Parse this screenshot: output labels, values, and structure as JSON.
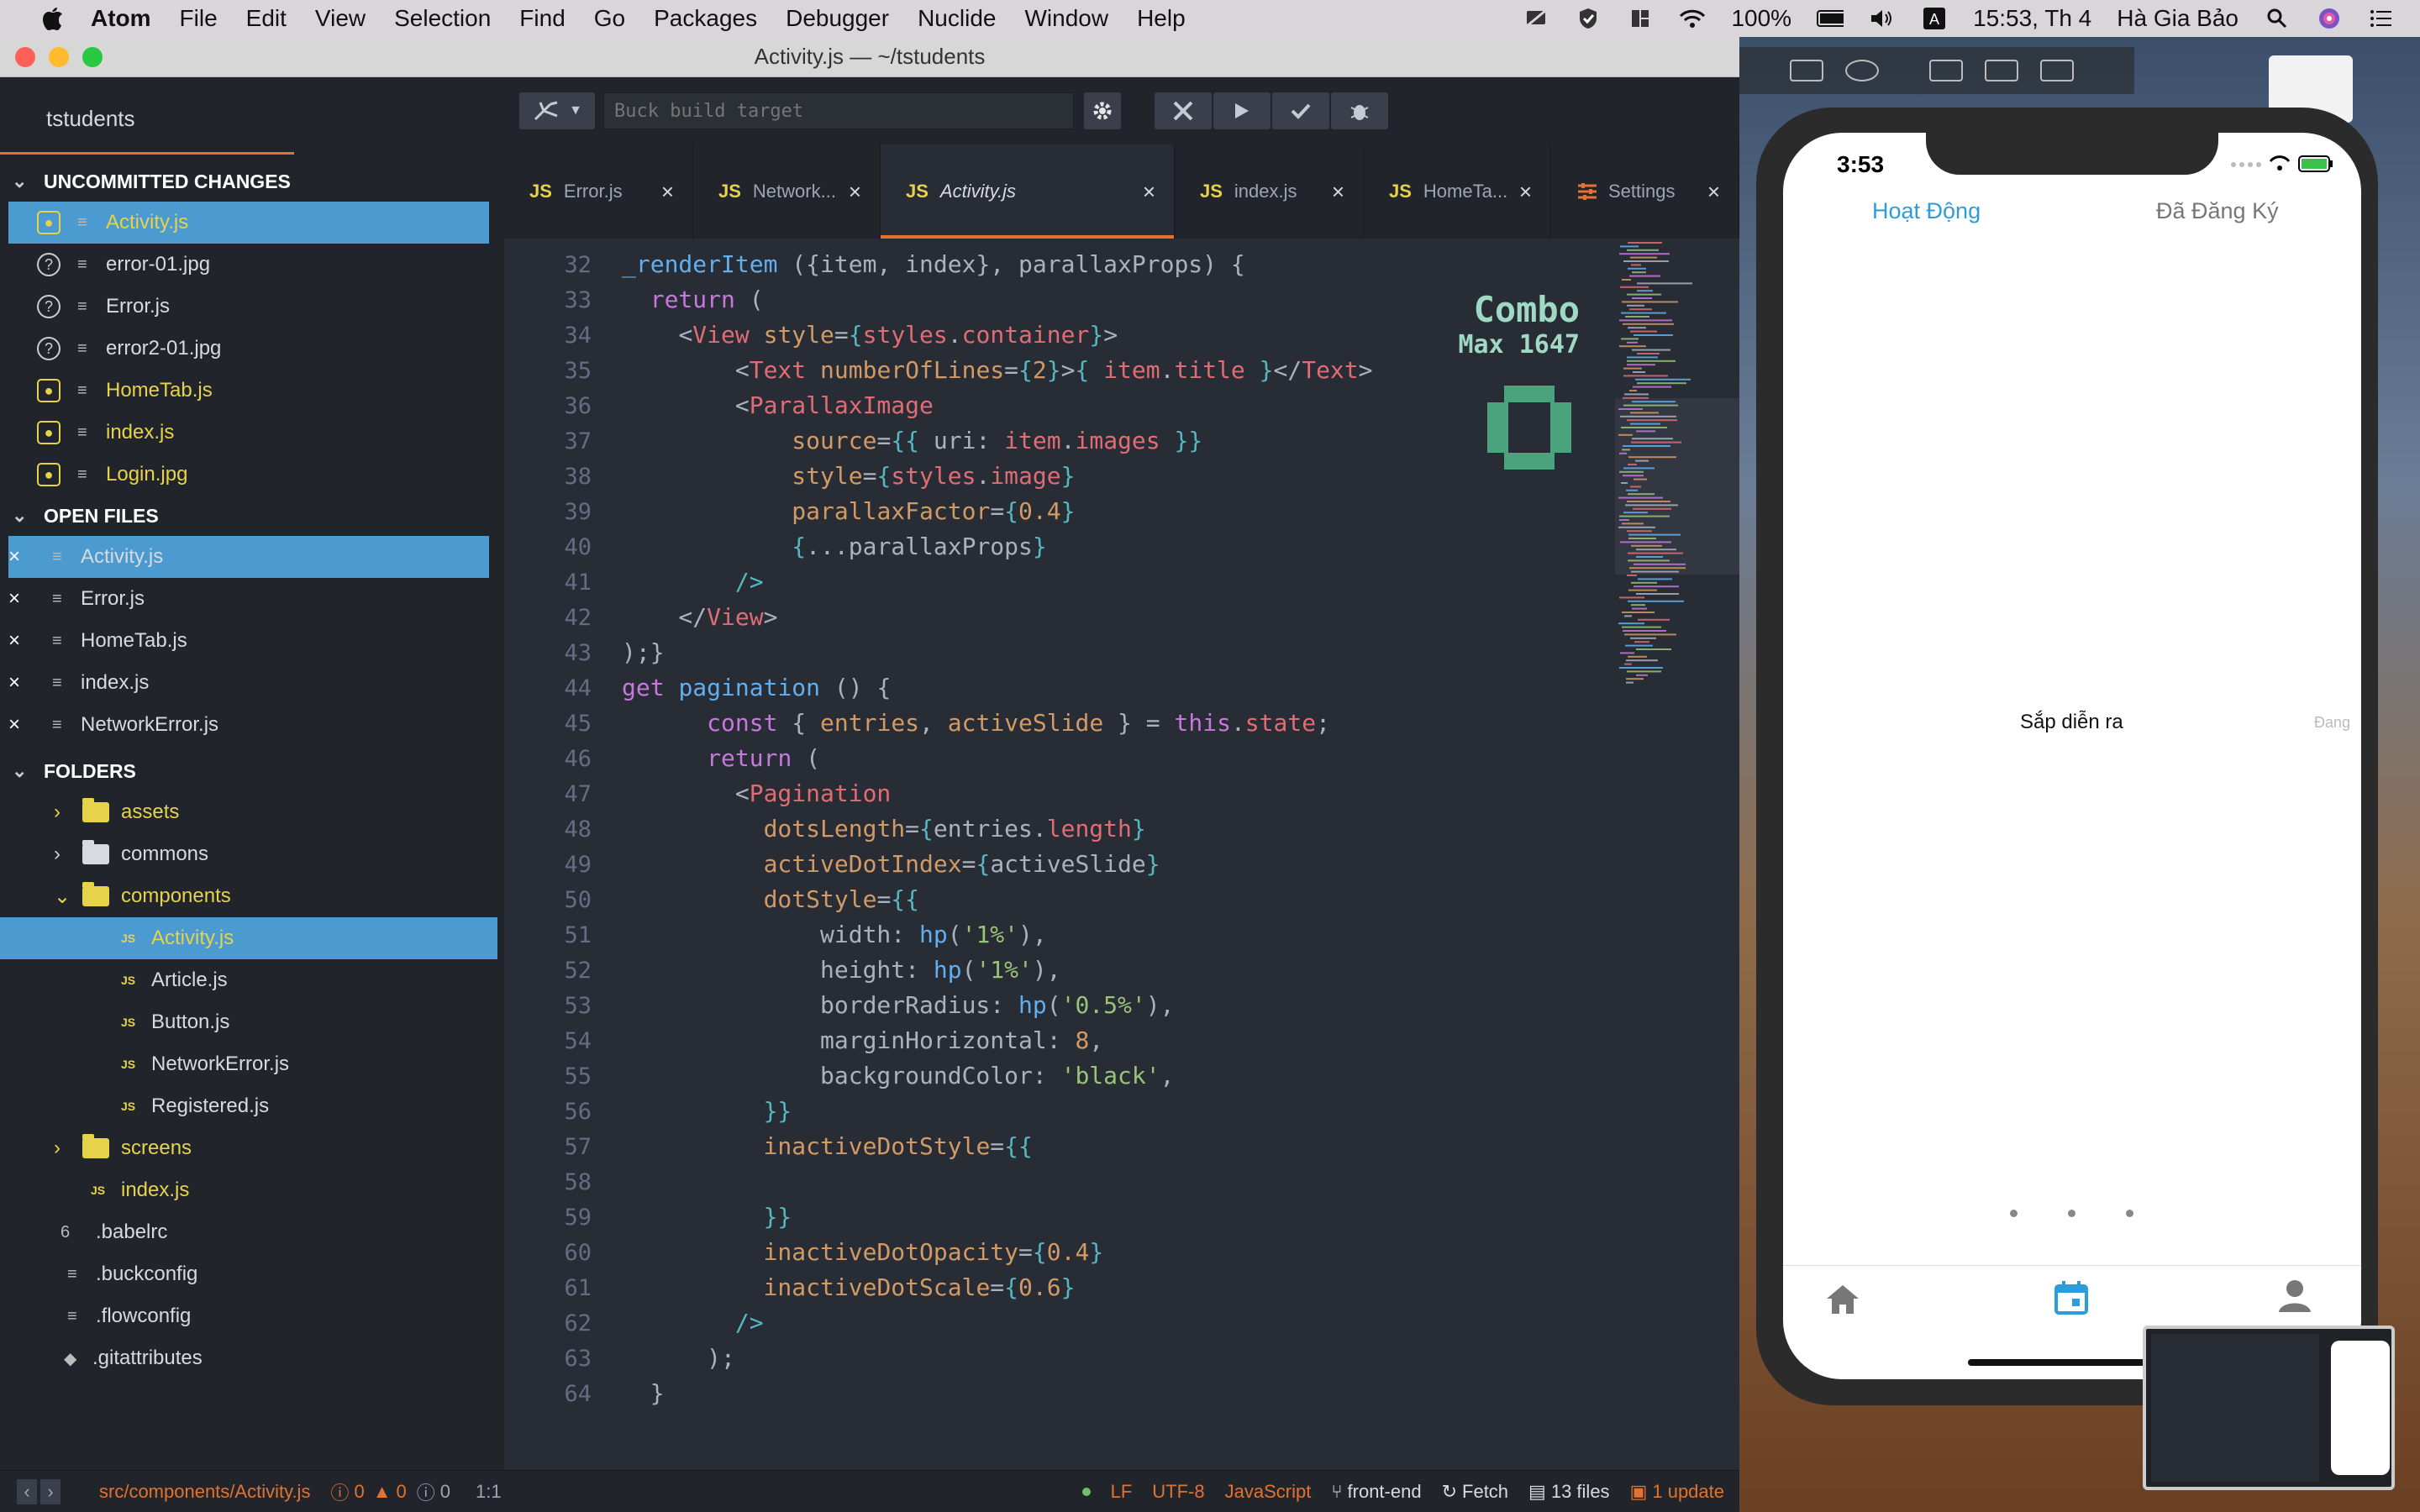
{
  "menubar": {
    "app": "Atom",
    "items": [
      "File",
      "Edit",
      "View",
      "Selection",
      "Find",
      "Go",
      "Packages",
      "Debugger",
      "Nuclide",
      "Window",
      "Help"
    ],
    "battery": "100%",
    "clock": "15:53, Th 4",
    "user": "Hà Gia Bảo"
  },
  "window": {
    "title": "Activity.js — ~/tstudents"
  },
  "tree": {
    "project": "tstudents",
    "uncommitted_title": "UNCOMMITTED CHANGES",
    "uncommitted": [
      {
        "name": "Activity.js",
        "status": "added"
      },
      {
        "name": "error-01.jpg",
        "status": "untracked"
      },
      {
        "name": "Error.js",
        "status": "untracked"
      },
      {
        "name": "error2-01.jpg",
        "status": "untracked"
      },
      {
        "name": "HomeTab.js",
        "status": "added"
      },
      {
        "name": "index.js",
        "status": "added"
      },
      {
        "name": "Login.jpg",
        "status": "added"
      }
    ],
    "open_files_title": "OPEN FILES",
    "open_files": [
      "Activity.js",
      "Error.js",
      "HomeTab.js",
      "index.js",
      "NetworkError.js"
    ],
    "folders_title": "FOLDERS",
    "folders": {
      "assets": "assets",
      "commons": "commons",
      "components": "components",
      "components_children": [
        "Activity.js",
        "Article.js",
        "Button.js",
        "NetworkError.js",
        "Registered.js"
      ],
      "screens": "screens",
      "root_files": [
        "index.js",
        ".babelrc",
        ".buckconfig",
        ".flowconfig",
        ".gitattributes"
      ]
    }
  },
  "toolbar": {
    "build_placeholder": "Buck build target"
  },
  "tabs": [
    {
      "label": "Error.js",
      "icon": "JS"
    },
    {
      "label": "Network...",
      "icon": "JS"
    },
    {
      "label": "Activity.js",
      "icon": "JS"
    },
    {
      "label": "index.js",
      "icon": "JS"
    },
    {
      "label": "HomeTa...",
      "icon": "JS"
    },
    {
      "label": "Settings",
      "icon": "settings-icon"
    }
  ],
  "editor": {
    "combo_title": "Combo",
    "combo_max": "Max 1647",
    "combo_count": "0",
    "line_numbers": [
      "32",
      "33",
      "34",
      "35",
      "36",
      "37",
      "38",
      "39",
      "40",
      "41",
      "42",
      "43",
      "44",
      "45",
      "46",
      "47",
      "48",
      "49",
      "50",
      "51",
      "52",
      "53",
      "54",
      "55",
      "56",
      "57",
      "58",
      "59",
      "60",
      "61",
      "62",
      "63",
      "64"
    ]
  },
  "statusbar": {
    "path": "src/components/Activity.js",
    "errors": "0",
    "warnings": "0",
    "infos": "0",
    "cursor": "1:1",
    "line_ending": "LF",
    "encoding": "UTF-8",
    "grammar": "JavaScript",
    "branch": "front-end",
    "fetch": "Fetch",
    "files": "13 files",
    "update": "1 update"
  },
  "simulator": {
    "time": "3:53",
    "tab_active": "Hoạt Động",
    "tab_inactive": "Đã Đăng Ký",
    "center_text": "Sắp diễn ra",
    "side_text": "Đang",
    "bottom_tabs": [
      "home-icon",
      "calendar-icon",
      "person-icon"
    ]
  },
  "colors": {
    "accent": "#e2722f",
    "selection": "#4c9bd0",
    "sim_blue": "#2d9cdb"
  }
}
